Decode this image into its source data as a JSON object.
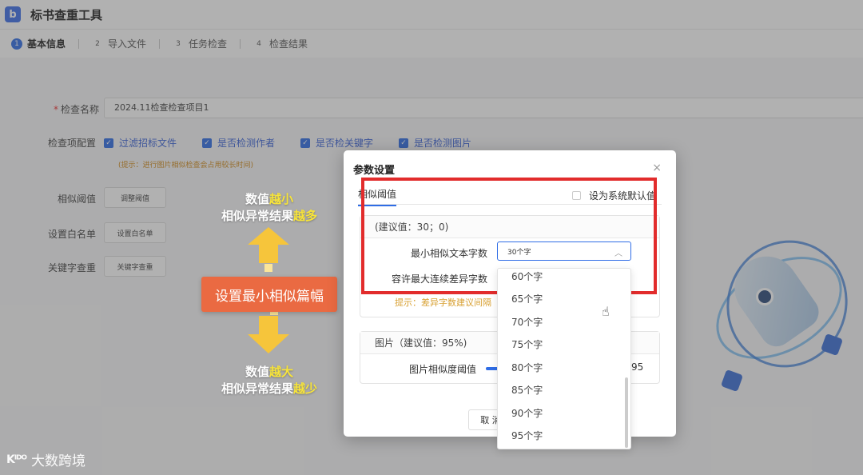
{
  "app": {
    "logo": "b",
    "title": "标书查重工具"
  },
  "steps": [
    {
      "num": "1",
      "label": "基本信息"
    },
    {
      "num": "2",
      "label": "导入文件"
    },
    {
      "num": "3",
      "label": "任务检查"
    },
    {
      "num": "4",
      "label": "检查结果"
    }
  ],
  "form": {
    "name_label": "检查名称",
    "name_value": "2024.11检查检查项目1",
    "config_label": "检查项配置",
    "checks": [
      "过滤招标文件",
      "是否检测作者",
      "是否检关键字",
      "是否检测图片"
    ],
    "hint": "(提示：进行图片相似检查会占用较长时间)",
    "threshold_label": "相似阈值",
    "threshold_button": "调整阈值",
    "whitelist_label": "设置白名单",
    "whitelist_button": "设置白名单",
    "keyword_label": "关键字查重",
    "keyword_button": "关键字查重"
  },
  "annotation": {
    "top_line1_pre": "数值",
    "top_line1_hl": "越小",
    "top_line2_pre": "相似异常结果",
    "top_line2_hl": "越多",
    "banner": "设置最小相似篇幅",
    "bottom_line1_pre": "数值",
    "bottom_line1_hl": "越大",
    "bottom_line2_pre": "相似异常结果",
    "bottom_line2_hl": "越少"
  },
  "dialog": {
    "title": "参数设置",
    "close": "×",
    "tab": "相似阈值",
    "default_checkbox": "设为系统默认值",
    "text_panel_head": "(建议值：30；0)",
    "min_chars_label": "最小相似文本字数",
    "min_chars_value": "30个字",
    "max_diff_label": "容许最大连续差异字数",
    "tip": "提示：差异字数建议间隔",
    "image_panel_head": "图片（建议值：95%)",
    "image_threshold_label": "图片相似度阈值",
    "image_threshold_value": "95",
    "image_threshold_fraction": 0.2,
    "cancel": "取 消"
  },
  "dropdown": {
    "options": [
      "60个字",
      "65个字",
      "70个字",
      "75个字",
      "80个字",
      "85个字",
      "90个字",
      "95个字"
    ]
  },
  "watermark": {
    "logo": "Kᴵᴰᴼ",
    "text": "大数跨境"
  }
}
